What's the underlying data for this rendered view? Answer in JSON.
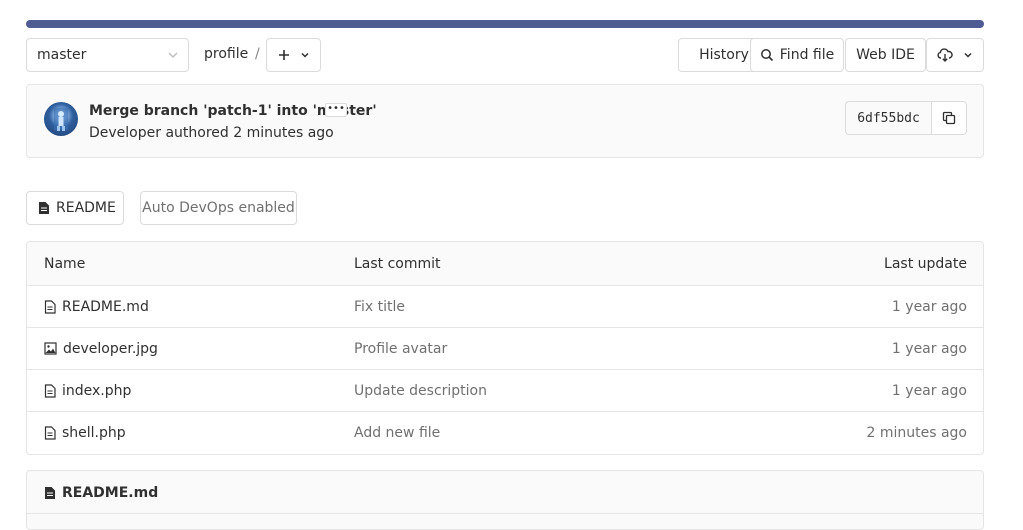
{
  "branch": {
    "name": "master"
  },
  "breadcrumb": {
    "project": "profile",
    "separator": "/"
  },
  "toolbar": {
    "history_label": "History",
    "find_file_label": "Find file",
    "web_ide_label": "Web IDE"
  },
  "commit": {
    "title": "Merge branch 'patch-1' into 'master'",
    "ellipsis": "•••",
    "meta": "Developer authored 2 minutes ago",
    "sha": "6df55bdc"
  },
  "badges": {
    "readme_label": "README",
    "auto_devops_label": "Auto DevOps enabled"
  },
  "table": {
    "headers": [
      "Name",
      "Last commit",
      "Last update"
    ],
    "rows": [
      {
        "name": "README.md",
        "icon": "file-icon",
        "commit": "Fix title",
        "updated": "1 year ago"
      },
      {
        "name": "developer.jpg",
        "icon": "image-file-icon",
        "commit": "Profile avatar",
        "updated": "1 year ago"
      },
      {
        "name": "index.php",
        "icon": "file-icon",
        "commit": "Update description",
        "updated": "1 year ago"
      },
      {
        "name": "shell.php",
        "icon": "file-icon",
        "commit": "Add new file",
        "updated": "2 minutes ago"
      }
    ]
  },
  "readme_panel": {
    "title": "README.md"
  },
  "colors": {
    "accent_bar": "#4f5b93",
    "border": "#e5e5e5",
    "muted_text": "#707070"
  }
}
